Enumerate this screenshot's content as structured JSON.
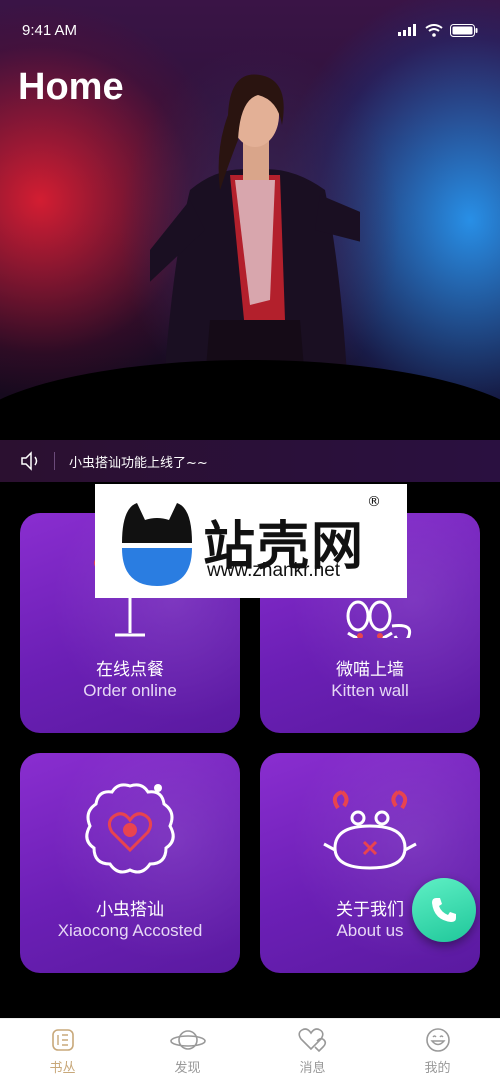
{
  "status_bar": {
    "time": "9:41 AM"
  },
  "header": {
    "title": "Home"
  },
  "notice": {
    "text": "小虫搭讪功能上线了~~"
  },
  "cards": [
    {
      "title_cn": "在线点餐",
      "title_en": "Order online",
      "icon": "wine-glass-icon"
    },
    {
      "title_cn": "微喵上墙",
      "title_en": "Kitten wall",
      "icon": "kitten-icon"
    },
    {
      "title_cn": "小虫搭讪",
      "title_en": "Xiaocong Accosted",
      "icon": "bug-heart-icon"
    },
    {
      "title_cn": "关于我们",
      "title_en": "About us",
      "icon": "crab-icon"
    }
  ],
  "watermark": {
    "brand": "站壳网",
    "url": "www.zhankr.net",
    "registered": "®"
  },
  "tabbar": {
    "items": [
      {
        "label": "书丛",
        "icon": "book-icon",
        "active": true
      },
      {
        "label": "发现",
        "icon": "planet-icon",
        "active": false
      },
      {
        "label": "消息",
        "icon": "heart-message-icon",
        "active": false
      },
      {
        "label": "我的",
        "icon": "smile-icon",
        "active": false
      }
    ]
  },
  "colors": {
    "card": "#7a26c4",
    "accent": "#c8a87a",
    "call": "#1fc79a",
    "icon_red": "#e8444f"
  }
}
